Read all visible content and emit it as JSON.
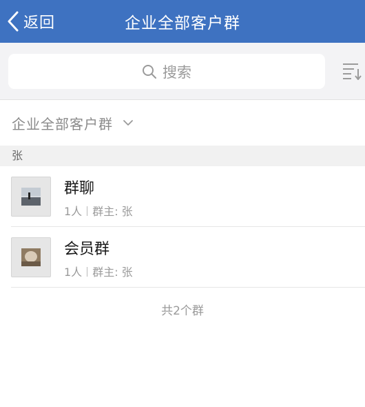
{
  "navbar": {
    "back_label": "返回",
    "title": "企业全部客户群"
  },
  "search": {
    "placeholder": "搜索"
  },
  "filter": {
    "label": "企业全部客户群"
  },
  "section": {
    "header": "张"
  },
  "groups": [
    {
      "name": "群聊",
      "member_count": "1人",
      "owner": "群主: 张"
    },
    {
      "name": "会员群",
      "member_count": "1人",
      "owner": "群主: 张"
    }
  ],
  "footer": {
    "count_text": "共2个群"
  },
  "colors": {
    "navbar": "#3e72c1",
    "background": "#ffffff",
    "section": "#f1f1f1"
  }
}
